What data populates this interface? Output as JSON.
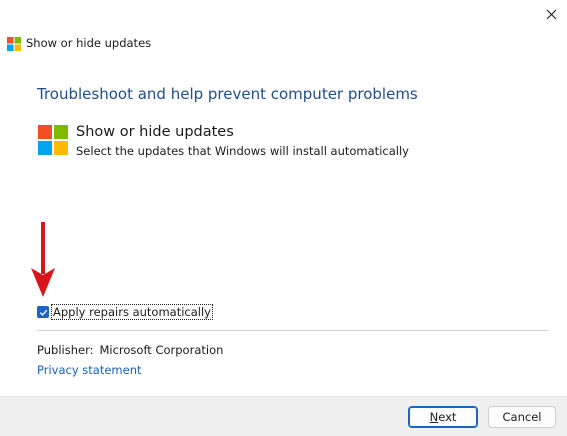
{
  "window": {
    "title": "Show or hide updates"
  },
  "content": {
    "heading": "Troubleshoot and help prevent computer problems",
    "item_title": "Show or hide updates",
    "item_description": "Select the updates that Windows will install automatically"
  },
  "options": {
    "apply_repairs_label": "Apply repairs automatically",
    "apply_repairs_checked": true
  },
  "publisher": {
    "label": "Publisher:",
    "value": "Microsoft Corporation"
  },
  "links": {
    "privacy": "Privacy statement"
  },
  "footer": {
    "next_accel": "N",
    "next_rest": "ext",
    "cancel_label": "Cancel"
  },
  "colors": {
    "heading": "#1f4e8c",
    "link": "#1a5fb4",
    "checkbox": "#1a64c4",
    "arrow": "#d9151b",
    "logo_red": "#f25022",
    "logo_green": "#7fba00",
    "logo_blue": "#00a4ef",
    "logo_yellow": "#ffb900"
  }
}
